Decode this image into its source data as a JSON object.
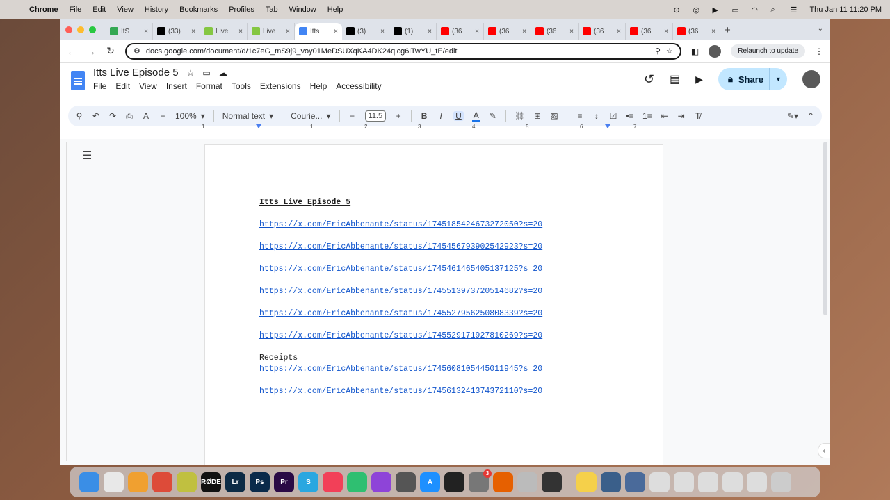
{
  "menubar": {
    "app": "Chrome",
    "items": [
      "File",
      "Edit",
      "View",
      "History",
      "Bookmarks",
      "Profiles",
      "Tab",
      "Window",
      "Help"
    ],
    "clock": "Thu Jan 11  11:20 PM"
  },
  "tabs": [
    {
      "title": "ItS",
      "favicon": "google-drive-icon",
      "color": "#34a853"
    },
    {
      "title": "(33)",
      "favicon": "x-icon",
      "color": "#000000"
    },
    {
      "title": "Live",
      "favicon": "rumble-icon",
      "color": "#85c742"
    },
    {
      "title": "Live",
      "favicon": "rumble-icon",
      "color": "#85c742"
    },
    {
      "title": "Itts",
      "favicon": "google-docs-icon",
      "color": "#4285f4",
      "active": true
    },
    {
      "title": "(3)",
      "favicon": "x-icon",
      "color": "#000000"
    },
    {
      "title": "(1)",
      "favicon": "x-icon",
      "color": "#000000"
    },
    {
      "title": "(36",
      "favicon": "youtube-icon",
      "color": "#ff0000"
    },
    {
      "title": "(36",
      "favicon": "youtube-icon",
      "color": "#ff0000"
    },
    {
      "title": "(36",
      "favicon": "youtube-icon",
      "color": "#ff0000"
    },
    {
      "title": "(36",
      "favicon": "youtube-icon",
      "color": "#ff0000"
    },
    {
      "title": "(36",
      "favicon": "youtube-icon",
      "color": "#ff0000"
    },
    {
      "title": "(36",
      "favicon": "youtube-icon",
      "color": "#ff0000"
    }
  ],
  "address": {
    "url": "docs.google.com/document/d/1c7eG_mS9j9_voy01MeDSUXqKA4DK24qlcg6lTwYU_tE/edit",
    "relaunch": "Relaunch to update"
  },
  "docs": {
    "title": "Itts Live Episode 5",
    "menus": [
      "File",
      "Edit",
      "View",
      "Insert",
      "Format",
      "Tools",
      "Extensions",
      "Help",
      "Accessibility"
    ],
    "share_label": "Share"
  },
  "toolbar": {
    "zoom": "100%",
    "style": "Normal text",
    "font": "Courie...",
    "font_size": "11.5"
  },
  "ruler": [
    "1",
    "1",
    "2",
    "3",
    "4",
    "5",
    "6",
    "7"
  ],
  "document": {
    "heading": "Itts Live Episode 5",
    "links_a": [
      "https://x.com/EricAbbenante/status/1745185424673272050?s=20",
      "https://x.com/EricAbbenante/status/1745456793902542923?s=20",
      "https://x.com/EricAbbenante/status/1745461465405137125?s=20",
      "https://x.com/EricAbbenante/status/1745513973720514682?s=20",
      "https://x.com/EricAbbenante/status/1745527956250808339?s=20",
      "https://x.com/EricAbbenante/status/1745529171927810269?s=20"
    ],
    "receipts_label": "Receipts",
    "links_b": [
      "https://x.com/EricAbbenante/status/1745608105445011945?s=20",
      "https://x.com/EricAbbenante/status/1745613241374372110?s=20"
    ]
  },
  "dock": [
    {
      "name": "finder-icon",
      "color": "#3a8ee6"
    },
    {
      "name": "launchpad-icon",
      "color": "#e8e8e8"
    },
    {
      "name": "photos-icon",
      "color": "#f0a030"
    },
    {
      "name": "chrome-icon",
      "color": "#dd4b39"
    },
    {
      "name": "cocktail-icon",
      "color": "#c0c040"
    },
    {
      "name": "rodecaster-icon",
      "color": "#111111",
      "label": "RØDE"
    },
    {
      "name": "lightroom-icon",
      "color": "#0d2b45",
      "label": "Lr"
    },
    {
      "name": "photoshop-icon",
      "color": "#0a2a4a",
      "label": "Ps"
    },
    {
      "name": "premiere-icon",
      "color": "#2a0a45",
      "label": "Pr"
    },
    {
      "name": "shazam-icon",
      "color": "#2aa7e0",
      "label": "S"
    },
    {
      "name": "music-icon",
      "color": "#f24058"
    },
    {
      "name": "facetime-icon",
      "color": "#2fbf71"
    },
    {
      "name": "podcasts-icon",
      "color": "#8e44d8"
    },
    {
      "name": "calculator-icon",
      "color": "#555555"
    },
    {
      "name": "app-store-icon",
      "color": "#1e90ff",
      "label": "A"
    },
    {
      "name": "obs-icon",
      "color": "#222222"
    },
    {
      "name": "system-settings-icon",
      "color": "#777777",
      "badge": "3"
    },
    {
      "name": "firefox-icon",
      "color": "#e66000"
    },
    {
      "name": "disk-utility-icon",
      "color": "#bbbbbb"
    },
    {
      "name": "final-cut-icon",
      "color": "#333333"
    },
    {
      "name": "notes-icon",
      "color": "#f5d04a"
    },
    {
      "name": "quicktime-icon",
      "color": "#3a5f8a"
    },
    {
      "name": "preview-icon",
      "color": "#4a6a9a"
    },
    {
      "name": "folder-thumb-icon",
      "color": "#dddddd"
    },
    {
      "name": "folder-thumb-icon",
      "color": "#dddddd"
    },
    {
      "name": "folder-thumb-icon",
      "color": "#dddddd"
    },
    {
      "name": "folder-thumb-icon",
      "color": "#dddddd"
    },
    {
      "name": "folder-thumb-icon",
      "color": "#dddddd"
    },
    {
      "name": "trash-icon",
      "color": "#cccccc"
    }
  ]
}
